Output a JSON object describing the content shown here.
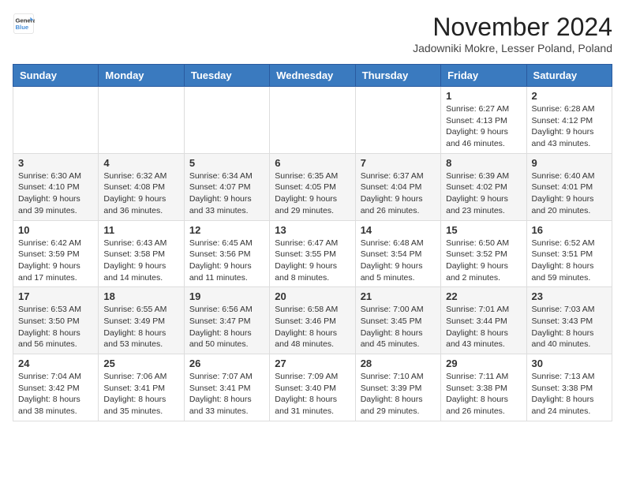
{
  "header": {
    "logo": {
      "line1": "General",
      "line2": "Blue"
    },
    "title": "November 2024",
    "location": "Jadowniki Mokre, Lesser Poland, Poland"
  },
  "days_of_week": [
    "Sunday",
    "Monday",
    "Tuesday",
    "Wednesday",
    "Thursday",
    "Friday",
    "Saturday"
  ],
  "weeks": [
    [
      {
        "day": "",
        "info": ""
      },
      {
        "day": "",
        "info": ""
      },
      {
        "day": "",
        "info": ""
      },
      {
        "day": "",
        "info": ""
      },
      {
        "day": "",
        "info": ""
      },
      {
        "day": "1",
        "info": "Sunrise: 6:27 AM\nSunset: 4:13 PM\nDaylight: 9 hours and 46 minutes."
      },
      {
        "day": "2",
        "info": "Sunrise: 6:28 AM\nSunset: 4:12 PM\nDaylight: 9 hours and 43 minutes."
      }
    ],
    [
      {
        "day": "3",
        "info": "Sunrise: 6:30 AM\nSunset: 4:10 PM\nDaylight: 9 hours and 39 minutes."
      },
      {
        "day": "4",
        "info": "Sunrise: 6:32 AM\nSunset: 4:08 PM\nDaylight: 9 hours and 36 minutes."
      },
      {
        "day": "5",
        "info": "Sunrise: 6:34 AM\nSunset: 4:07 PM\nDaylight: 9 hours and 33 minutes."
      },
      {
        "day": "6",
        "info": "Sunrise: 6:35 AM\nSunset: 4:05 PM\nDaylight: 9 hours and 29 minutes."
      },
      {
        "day": "7",
        "info": "Sunrise: 6:37 AM\nSunset: 4:04 PM\nDaylight: 9 hours and 26 minutes."
      },
      {
        "day": "8",
        "info": "Sunrise: 6:39 AM\nSunset: 4:02 PM\nDaylight: 9 hours and 23 minutes."
      },
      {
        "day": "9",
        "info": "Sunrise: 6:40 AM\nSunset: 4:01 PM\nDaylight: 9 hours and 20 minutes."
      }
    ],
    [
      {
        "day": "10",
        "info": "Sunrise: 6:42 AM\nSunset: 3:59 PM\nDaylight: 9 hours and 17 minutes."
      },
      {
        "day": "11",
        "info": "Sunrise: 6:43 AM\nSunset: 3:58 PM\nDaylight: 9 hours and 14 minutes."
      },
      {
        "day": "12",
        "info": "Sunrise: 6:45 AM\nSunset: 3:56 PM\nDaylight: 9 hours and 11 minutes."
      },
      {
        "day": "13",
        "info": "Sunrise: 6:47 AM\nSunset: 3:55 PM\nDaylight: 9 hours and 8 minutes."
      },
      {
        "day": "14",
        "info": "Sunrise: 6:48 AM\nSunset: 3:54 PM\nDaylight: 9 hours and 5 minutes."
      },
      {
        "day": "15",
        "info": "Sunrise: 6:50 AM\nSunset: 3:52 PM\nDaylight: 9 hours and 2 minutes."
      },
      {
        "day": "16",
        "info": "Sunrise: 6:52 AM\nSunset: 3:51 PM\nDaylight: 8 hours and 59 minutes."
      }
    ],
    [
      {
        "day": "17",
        "info": "Sunrise: 6:53 AM\nSunset: 3:50 PM\nDaylight: 8 hours and 56 minutes."
      },
      {
        "day": "18",
        "info": "Sunrise: 6:55 AM\nSunset: 3:49 PM\nDaylight: 8 hours and 53 minutes."
      },
      {
        "day": "19",
        "info": "Sunrise: 6:56 AM\nSunset: 3:47 PM\nDaylight: 8 hours and 50 minutes."
      },
      {
        "day": "20",
        "info": "Sunrise: 6:58 AM\nSunset: 3:46 PM\nDaylight: 8 hours and 48 minutes."
      },
      {
        "day": "21",
        "info": "Sunrise: 7:00 AM\nSunset: 3:45 PM\nDaylight: 8 hours and 45 minutes."
      },
      {
        "day": "22",
        "info": "Sunrise: 7:01 AM\nSunset: 3:44 PM\nDaylight: 8 hours and 43 minutes."
      },
      {
        "day": "23",
        "info": "Sunrise: 7:03 AM\nSunset: 3:43 PM\nDaylight: 8 hours and 40 minutes."
      }
    ],
    [
      {
        "day": "24",
        "info": "Sunrise: 7:04 AM\nSunset: 3:42 PM\nDaylight: 8 hours and 38 minutes."
      },
      {
        "day": "25",
        "info": "Sunrise: 7:06 AM\nSunset: 3:41 PM\nDaylight: 8 hours and 35 minutes."
      },
      {
        "day": "26",
        "info": "Sunrise: 7:07 AM\nSunset: 3:41 PM\nDaylight: 8 hours and 33 minutes."
      },
      {
        "day": "27",
        "info": "Sunrise: 7:09 AM\nSunset: 3:40 PM\nDaylight: 8 hours and 31 minutes."
      },
      {
        "day": "28",
        "info": "Sunrise: 7:10 AM\nSunset: 3:39 PM\nDaylight: 8 hours and 29 minutes."
      },
      {
        "day": "29",
        "info": "Sunrise: 7:11 AM\nSunset: 3:38 PM\nDaylight: 8 hours and 26 minutes."
      },
      {
        "day": "30",
        "info": "Sunrise: 7:13 AM\nSunset: 3:38 PM\nDaylight: 8 hours and 24 minutes."
      }
    ]
  ]
}
